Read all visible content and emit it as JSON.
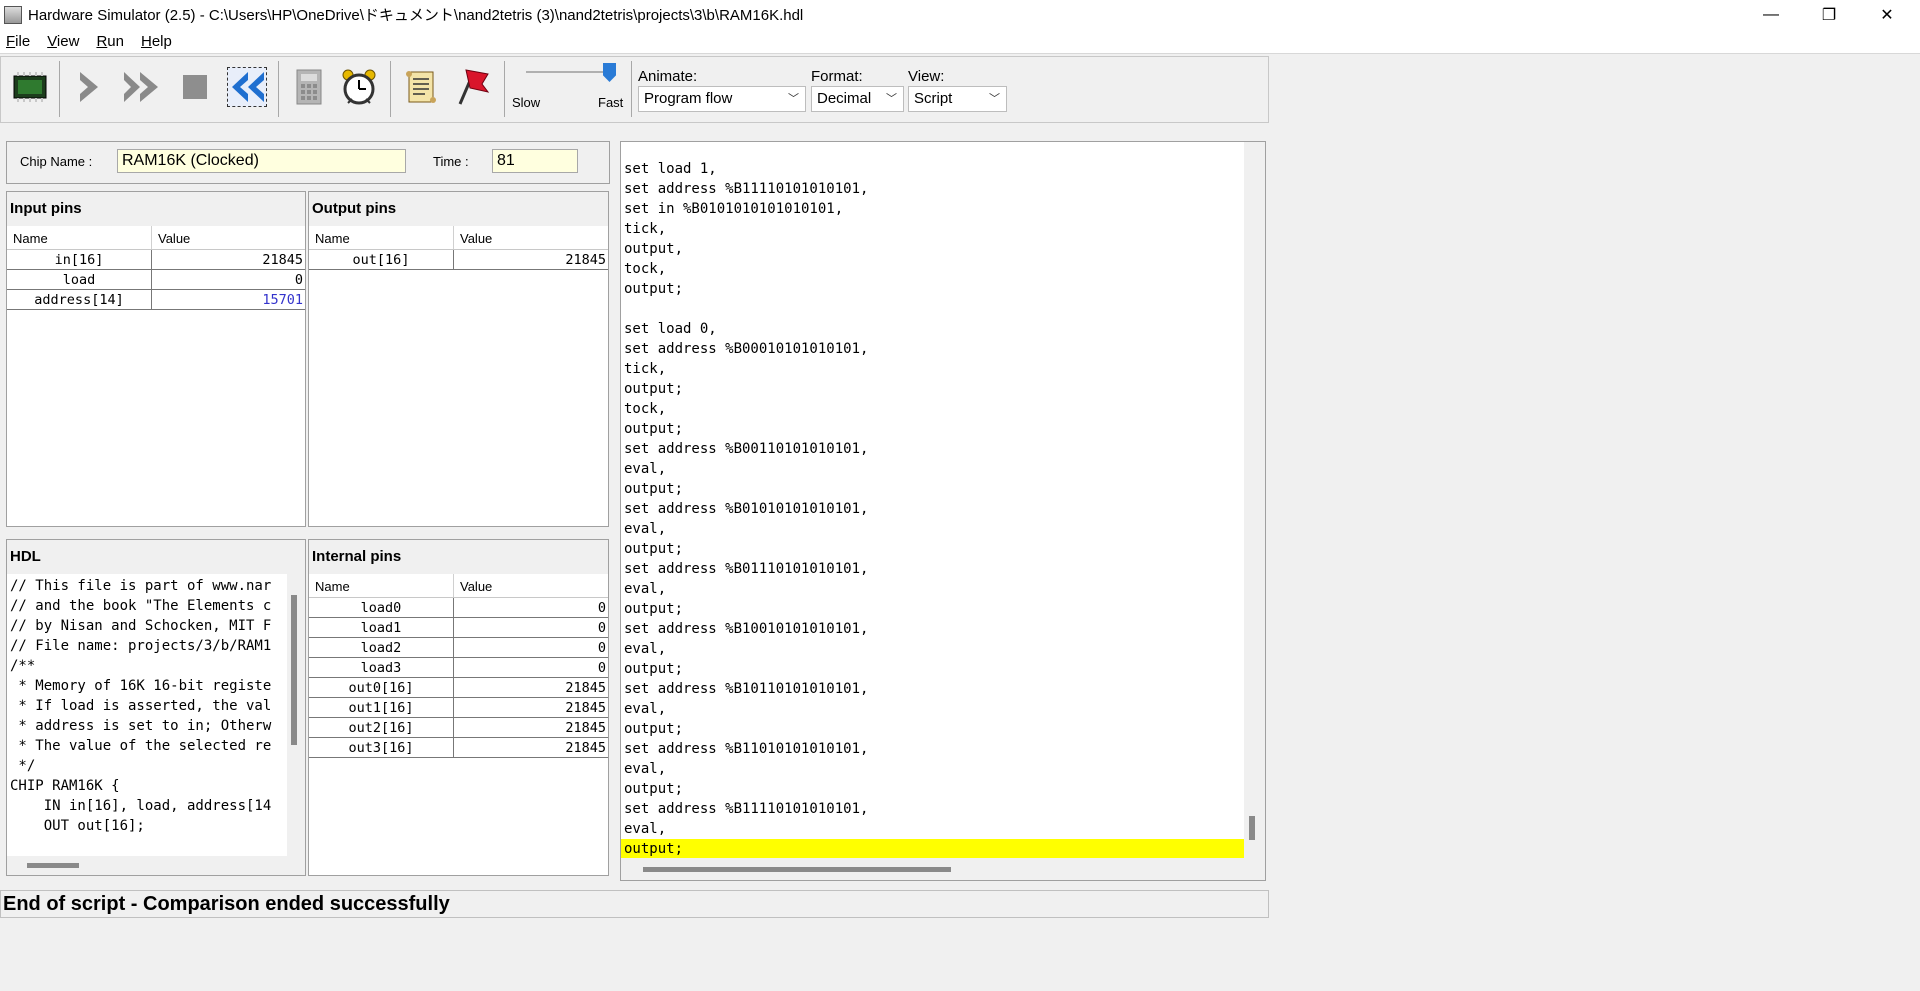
{
  "window": {
    "title": "Hardware Simulator (2.5) - C:\\Users\\HP\\OneDrive\\ドキュメント\\nand2tetris (3)\\nand2tetris\\projects\\3\\b\\RAM16K.hdl",
    "minimize": "—",
    "maximize": "❐",
    "close": "✕"
  },
  "menu": [
    "File",
    "View",
    "Run",
    "Help"
  ],
  "toolbar": {
    "speed_slow": "Slow",
    "speed_fast": "Fast",
    "speed_level": 1.0,
    "animate_label": "Animate:",
    "animate_value": "Program flow",
    "format_label": "Format:",
    "format_value": "Decimal",
    "view_label": "View:",
    "view_value": "Script",
    "icons": [
      "load-chip-icon",
      "single-step-icon",
      "fast-forward-icon",
      "stop-icon",
      "rewind-icon",
      "eval-icon",
      "clock-icon",
      "load-script-icon",
      "breakpoints-icon"
    ]
  },
  "chip": {
    "name_label": "Chip Name :",
    "name_value": "RAM16K (Clocked)",
    "time_label": "Time :",
    "time_value": "81"
  },
  "input_pins": {
    "title": "Input pins",
    "col_name": "Name",
    "col_value": "Value",
    "rows": [
      {
        "name": "in[16]",
        "value": "21845",
        "highlight": false
      },
      {
        "name": "load",
        "value": "0",
        "highlight": false
      },
      {
        "name": "address[14]",
        "value": "15701",
        "highlight": true
      }
    ]
  },
  "output_pins": {
    "title": "Output pins",
    "col_name": "Name",
    "col_value": "Value",
    "rows": [
      {
        "name": "out[16]",
        "value": "21845"
      }
    ]
  },
  "hdl": {
    "title": "HDL",
    "lines": [
      "// This file is part of www.nar",
      "// and the book \"The Elements c",
      "// by Nisan and Schocken, MIT F",
      "// File name: projects/3/b/RAM1",
      "/**",
      " * Memory of 16K 16-bit registe",
      " * If load is asserted, the val",
      " * address is set to in; Otherw",
      " * The value of the selected re",
      " */",
      "CHIP RAM16K {",
      "    IN in[16], load, address[14",
      "    OUT out[16];"
    ]
  },
  "internal_pins": {
    "title": "Internal pins",
    "col_name": "Name",
    "col_value": "Value",
    "rows": [
      {
        "name": "load0",
        "value": "0"
      },
      {
        "name": "load1",
        "value": "0"
      },
      {
        "name": "load2",
        "value": "0"
      },
      {
        "name": "load3",
        "value": "0"
      },
      {
        "name": "out0[16]",
        "value": "21845"
      },
      {
        "name": "out1[16]",
        "value": "21845"
      },
      {
        "name": "out2[16]",
        "value": "21845"
      },
      {
        "name": "out3[16]",
        "value": "21845"
      }
    ]
  },
  "script": {
    "lines": [
      "set load 1,",
      "set address %B11110101010101,",
      "set in %B0101010101010101,",
      "tick,",
      "output,",
      "tock,",
      "output;",
      "",
      "set load 0,",
      "set address %B00010101010101,",
      "tick,",
      "output;",
      "tock,",
      "output;",
      "set address %B00110101010101,",
      "eval,",
      "output;",
      "set address %B01010101010101,",
      "eval,",
      "output;",
      "set address %B01110101010101,",
      "eval,",
      "output;",
      "set address %B10010101010101,",
      "eval,",
      "output;",
      "set address %B10110101010101,",
      "eval,",
      "output;",
      "set address %B11010101010101,",
      "eval,",
      "output;",
      "set address %B11110101010101,",
      "eval,",
      "output;"
    ],
    "current_line": 34,
    "highlight_color": "#ffff00"
  },
  "status": {
    "message": "End of script - Comparison ended successfully"
  }
}
